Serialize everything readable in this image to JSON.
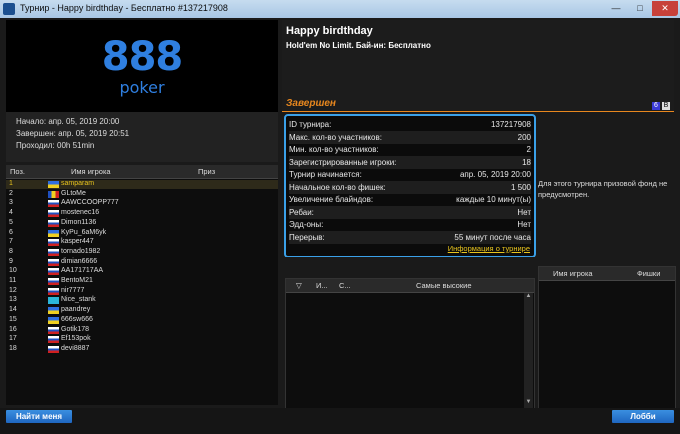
{
  "window": {
    "title": "Турнир - Happy birdthday - Бесплатно #137217908",
    "min": "—",
    "max": "□",
    "close": "✕"
  },
  "logo": {
    "brand": "888",
    "sub": "poker"
  },
  "times": {
    "start": "Начало: апр. 05, 2019 20:00",
    "end": "Завершен: апр. 05, 2019 20:51",
    "elapsed": "Проходил: 00h 51min"
  },
  "header": {
    "name": "Happy birdthday",
    "subtitle": "Hold'em No Limit. Бай-ин: Бесплатно",
    "status": "Завершен",
    "badge1": "6",
    "badge2": "B"
  },
  "info": {
    "rows": [
      {
        "label": "ID турнира:",
        "value": "137217908"
      },
      {
        "label": "Макс. кол-во участников:",
        "value": "200"
      },
      {
        "label": "Мин. кол-во участников:",
        "value": "2"
      },
      {
        "label": "Зарегистрированные игроки:",
        "value": "18"
      },
      {
        "label": "Турнир начинается:",
        "value": "апр. 05, 2019 20:00"
      },
      {
        "label": "Начальное кол-во фишек:",
        "value": "1 500"
      },
      {
        "label": "Увеличение блайндов:",
        "value": "каждые 10 минут(ы)"
      },
      {
        "label": "Ребаи:",
        "value": "Нет"
      },
      {
        "label": "Эдд-оны:",
        "value": "Нет"
      },
      {
        "label": "Перерыв:",
        "value": "55 минут после часа"
      }
    ],
    "link": "Информация о турнире"
  },
  "prize": {
    "text": "Для этого турнира призовой фонд не предусмотрен."
  },
  "players": {
    "headers": {
      "pos": "Поз.",
      "name": "Имя игрока",
      "prize": "Приз"
    },
    "rows": [
      {
        "pos": "1",
        "name": "samparam"
      },
      {
        "pos": "2",
        "name": "GLtoMe"
      },
      {
        "pos": "3",
        "name": "AAWCCOOPP777"
      },
      {
        "pos": "4",
        "name": "mostenec16"
      },
      {
        "pos": "5",
        "name": "Dimon1136"
      },
      {
        "pos": "6",
        "name": "KyPu_6aM6yk"
      },
      {
        "pos": "7",
        "name": "kasper447"
      },
      {
        "pos": "8",
        "name": "tornado1982"
      },
      {
        "pos": "9",
        "name": "dimian6666"
      },
      {
        "pos": "10",
        "name": "AA171717AA"
      },
      {
        "pos": "11",
        "name": "BentoM21"
      },
      {
        "pos": "12",
        "name": "nir7777"
      },
      {
        "pos": "13",
        "name": "Nice_stank"
      },
      {
        "pos": "14",
        "name": "paandrey"
      },
      {
        "pos": "15",
        "name": "666sw666"
      },
      {
        "pos": "16",
        "name": "Gotik178"
      },
      {
        "pos": "17",
        "name": "Ef153pok"
      },
      {
        "pos": "18",
        "name": "devi8887"
      }
    ]
  },
  "highest": {
    "col_arrow": "▽",
    "col_i": "И...",
    "col_c": "С...",
    "col_main": "Самые высокие",
    "up": "▲",
    "down": "▼"
  },
  "chips": {
    "name": "Имя игрока",
    "chips": "Фишки"
  },
  "buttons": {
    "find_me": "Найти меня",
    "lobby": "Лобби"
  },
  "colors": {
    "accent": "#3aa0e8",
    "status": "#e8871e",
    "link": "#e8c41e"
  }
}
